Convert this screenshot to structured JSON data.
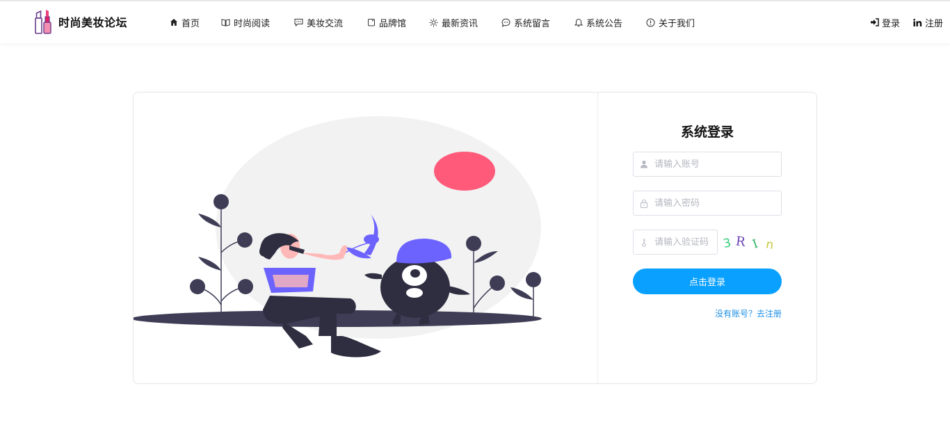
{
  "brand": {
    "name": "时尚美妆论坛",
    "icon": "lipstick-icon"
  },
  "nav": {
    "items": [
      {
        "label": "首页",
        "icon": "home-icon"
      },
      {
        "label": "时尚阅读",
        "icon": "book-icon"
      },
      {
        "label": "美妆交流",
        "icon": "chat-icon"
      },
      {
        "label": "品牌馆",
        "icon": "tag-icon"
      },
      {
        "label": "最新资讯",
        "icon": "sun-icon"
      },
      {
        "label": "系统留言",
        "icon": "message-icon"
      },
      {
        "label": "系统公告",
        "icon": "bell-icon"
      },
      {
        "label": "关于我们",
        "icon": "info-icon"
      }
    ]
  },
  "auth": {
    "login_label": "登录",
    "register_label": "注册"
  },
  "login": {
    "title": "系统登录",
    "username_placeholder": "请输入账号",
    "password_placeholder": "请输入密码",
    "captcha_placeholder": "请输入验证码",
    "captcha_chars": [
      "3",
      "R",
      "I",
      "n"
    ],
    "captcha_colors": [
      "#2ecc71",
      "#6a3fb5",
      "#27ae60",
      "#c7c93a"
    ],
    "submit_label": "点击登录",
    "register_link": "没有账号？去注册"
  },
  "colors": {
    "accent": "#09a0ff",
    "link": "#1e90e6",
    "illus_purple": "#6c63ff",
    "illus_red": "#ff5a7a",
    "illus_dark": "#2f2e41"
  }
}
